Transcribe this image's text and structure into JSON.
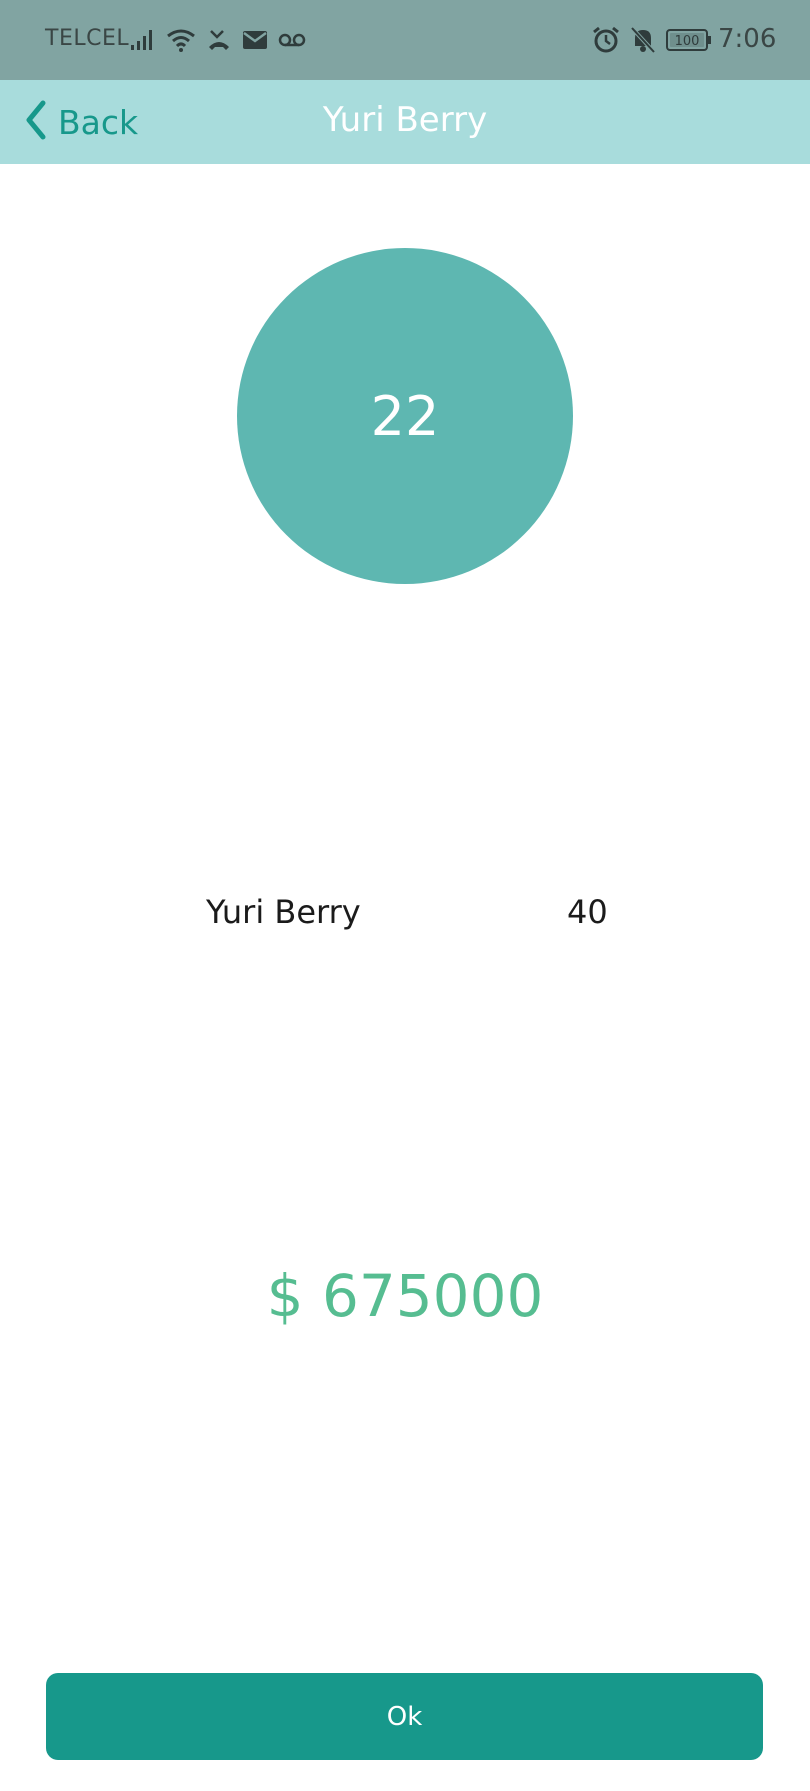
{
  "status_bar": {
    "carrier": "TELCEL",
    "time": "7:06",
    "battery": "100",
    "icons_left": [
      "signal-icon",
      "wifi-icon",
      "missed-call-icon",
      "mail-icon",
      "voicemail-icon"
    ],
    "icons_right": [
      "alarm-icon",
      "bell-off-icon",
      "battery-icon"
    ]
  },
  "nav": {
    "back_label": "Back",
    "title": "Yuri Berry"
  },
  "circle": {
    "value": "22"
  },
  "info_row": {
    "name": "Yuri Berry",
    "value": "40"
  },
  "amount": "$ 675000",
  "ok_button": {
    "label": "Ok"
  },
  "colors": {
    "status_bar": "#81a4a2",
    "nav_bar": "#a8dcdc",
    "accent": "#17988b",
    "circle": "#5eb7b1",
    "amount": "#56bd91"
  }
}
